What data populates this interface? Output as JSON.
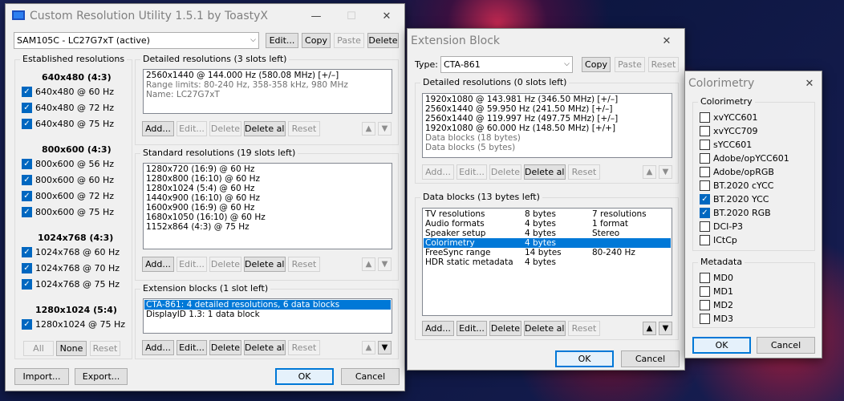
{
  "main": {
    "title": "Custom Resolution Utility 1.5.1 by ToastyX",
    "window_controls": {
      "minimize": "—",
      "maximize": "☐",
      "close": "✕"
    },
    "monitor_select": "SAM105C - LC27G7xT (active)",
    "top_buttons": [
      "Edit...",
      "Copy",
      "Paste",
      "Delete"
    ],
    "established": {
      "label": "Established resolutions",
      "groups": [
        {
          "header": "640x480 (4:3)",
          "items": [
            {
              "label": "640x480 @ 60 Hz",
              "checked": true
            },
            {
              "label": "640x480 @ 72 Hz",
              "checked": true
            },
            {
              "label": "640x480 @ 75 Hz",
              "checked": true
            }
          ]
        },
        {
          "header": "800x600 (4:3)",
          "items": [
            {
              "label": "800x600 @ 56 Hz",
              "checked": true
            },
            {
              "label": "800x600 @ 60 Hz",
              "checked": true
            },
            {
              "label": "800x600 @ 72 Hz",
              "checked": true
            },
            {
              "label": "800x600 @ 75 Hz",
              "checked": true
            }
          ]
        },
        {
          "header": "1024x768 (4:3)",
          "items": [
            {
              "label": "1024x768 @ 60 Hz",
              "checked": true
            },
            {
              "label": "1024x768 @ 70 Hz",
              "checked": true
            },
            {
              "label": "1024x768 @ 75 Hz",
              "checked": true
            }
          ]
        },
        {
          "header": "1280x1024 (5:4)",
          "items": [
            {
              "label": "1280x1024 @ 75 Hz",
              "checked": true
            }
          ]
        }
      ],
      "buttons": [
        "All",
        "None",
        "Reset"
      ]
    },
    "detailed": {
      "label": "Detailed resolutions (3 slots left)",
      "rows": [
        "2560x1440 @ 144.000 Hz (580.08 MHz) [+/–]",
        "Range limits: 80-240 Hz, 358-358 kHz, 980 MHz",
        "Name: LC27G7xT"
      ],
      "buttons": [
        "Add...",
        "Edit...",
        "Delete",
        "Delete all",
        "Reset"
      ]
    },
    "standard": {
      "label": "Standard resolutions (19 slots left)",
      "rows": [
        "1280x720 (16:9) @ 60 Hz",
        "1280x800 (16:10) @ 60 Hz",
        "1280x1024 (5:4) @ 60 Hz",
        "1440x900 (16:10) @ 60 Hz",
        "1600x900 (16:9) @ 60 Hz",
        "1680x1050 (16:10) @ 60 Hz",
        "1152x864 (4:3) @ 75 Hz"
      ],
      "buttons": [
        "Add...",
        "Edit...",
        "Delete",
        "Delete all",
        "Reset"
      ]
    },
    "extension": {
      "label": "Extension blocks (1 slot left)",
      "rows": [
        "CTA-861: 4 detailed resolutions, 6 data blocks",
        "DisplayID 1.3: 1 data block"
      ],
      "buttons": [
        "Add...",
        "Edit...",
        "Delete",
        "Delete all",
        "Reset"
      ]
    },
    "bottom_buttons": [
      "Import...",
      "Export...",
      "OK",
      "Cancel"
    ]
  },
  "ext": {
    "title": "Extension Block",
    "close": "✕",
    "type_label": "Type:",
    "type_value": "CTA-861",
    "top_buttons": [
      "Copy",
      "Paste",
      "Reset"
    ],
    "detailed": {
      "label": "Detailed resolutions (0 slots left)",
      "rows": [
        "1920x1080 @ 143.981 Hz (346.50 MHz) [+/–]",
        "2560x1440 @ 59.950 Hz (241.50 MHz) [+/–]",
        "2560x1440 @ 119.997 Hz (497.75 MHz) [+/–]",
        "1920x1080 @ 60.000 Hz (148.50 MHz) [+/+]",
        "Data blocks (18 bytes)",
        "Data blocks (5 bytes)"
      ],
      "buttons": [
        "Add...",
        "Edit...",
        "Delete",
        "Delete all",
        "Reset"
      ]
    },
    "datablocks": {
      "label": "Data blocks (13 bytes left)",
      "rows": [
        {
          "c1": "TV resolutions",
          "c2": "8 bytes",
          "c3": "7 resolutions"
        },
        {
          "c1": "Audio formats",
          "c2": "4 bytes",
          "c3": "1 format"
        },
        {
          "c1": "Speaker setup",
          "c2": "4 bytes",
          "c3": "Stereo"
        },
        {
          "c1": "Colorimetry",
          "c2": "4 bytes",
          "c3": ""
        },
        {
          "c1": "FreeSync range",
          "c2": "14 bytes",
          "c3": "80-240 Hz"
        },
        {
          "c1": "HDR static metadata",
          "c2": "4 bytes",
          "c3": ""
        }
      ],
      "buttons": [
        "Add...",
        "Edit...",
        "Delete",
        "Delete all",
        "Reset"
      ]
    },
    "bottom_buttons": [
      "OK",
      "Cancel"
    ]
  },
  "color": {
    "title": "Colorimetry",
    "close": "✕",
    "colorimetry_label": "Colorimetry",
    "colorimetry": [
      {
        "label": "xvYCC601",
        "checked": false
      },
      {
        "label": "xvYCC709",
        "checked": false
      },
      {
        "label": "sYCC601",
        "checked": false
      },
      {
        "label": "Adobe/opYCC601",
        "checked": false
      },
      {
        "label": "Adobe/opRGB",
        "checked": false
      },
      {
        "label": "BT.2020 cYCC",
        "checked": false
      },
      {
        "label": "BT.2020 YCC",
        "checked": true
      },
      {
        "label": "BT.2020 RGB",
        "checked": true
      },
      {
        "label": "DCI-P3",
        "checked": false
      },
      {
        "label": "ICtCp",
        "checked": false
      }
    ],
    "metadata_label": "Metadata",
    "metadata": [
      {
        "label": "MD0",
        "checked": false
      },
      {
        "label": "MD1",
        "checked": false
      },
      {
        "label": "MD2",
        "checked": false
      },
      {
        "label": "MD3",
        "checked": false
      }
    ],
    "bottom_buttons": [
      "OK",
      "Cancel"
    ]
  }
}
